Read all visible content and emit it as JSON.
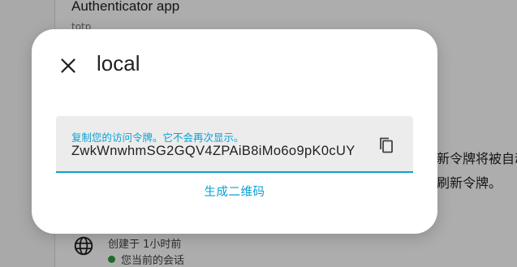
{
  "background": {
    "app_title": "Authenticator app",
    "app_subtitle": "totp",
    "right_text_line1": "新令牌将被自动",
    "right_text_line2": "刷新令牌。",
    "session_created": "创建于 1小时前",
    "session_current": "您当前的会话",
    "icons": {
      "globe": "globe-icon",
      "status_dot": "green-dot"
    }
  },
  "dialog": {
    "title": "local",
    "close_icon": "close-icon",
    "token_label": "复制您的访问令牌。它不会再次显示。",
    "token_value": "ZwkWnwhmSG2GQV4ZPAiB8iMo6o9pK0cUY",
    "copy_icon": "copy-icon",
    "qr_link": "生成二维码"
  },
  "colors": {
    "accent": "#0aa1d6",
    "scrim": "rgba(0,0,0,0.32)",
    "field_bg": "#ececec",
    "status_green": "#2e9e3e"
  }
}
